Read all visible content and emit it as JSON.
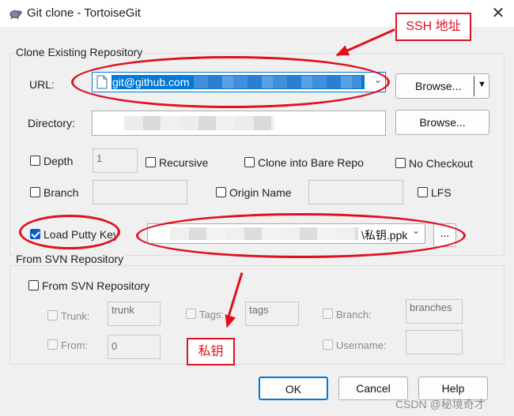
{
  "window": {
    "title": "Git clone - TortoiseGit",
    "close_glyph": "✕"
  },
  "clone_existing": {
    "group_label": "Clone Existing Repository",
    "url_label": "URL:",
    "url_value": "git@github.com",
    "browse1": "Browse...",
    "directory_label": "Directory:",
    "browse2": "Browse...",
    "depth_label": "Depth",
    "depth_value": "1",
    "recursive_label": "Recursive",
    "bare_label": "Clone into Bare Repo",
    "no_checkout_label": "No Checkout",
    "branch_label": "Branch",
    "origin_label": "Origin Name",
    "lfs_label": "LFS",
    "putty_label": "Load Putty Key",
    "putty_value": "\\私钥.ppk",
    "putty_browse": "..."
  },
  "svn": {
    "group_label": "From SVN Repository",
    "from_svn_label": "From SVN Repository",
    "trunk_label": "Trunk:",
    "trunk_value": "trunk",
    "tags_label": "Tags:",
    "tags_value": "tags",
    "branch_label": "Branch:",
    "branch_value": "branches",
    "from_label": "From:",
    "from_value": "0",
    "username_label": "Username:"
  },
  "buttons": {
    "ok": "OK",
    "cancel": "Cancel",
    "help": "Help"
  },
  "annotations": {
    "ssh": "SSH 地址",
    "key": "私钥"
  },
  "watermark": "CSDN @秘境奇才",
  "colors": {
    "annotation_red": "#e01020",
    "checkbox_blue": "#0a5fc5",
    "selection_blue": "#0078d7"
  }
}
